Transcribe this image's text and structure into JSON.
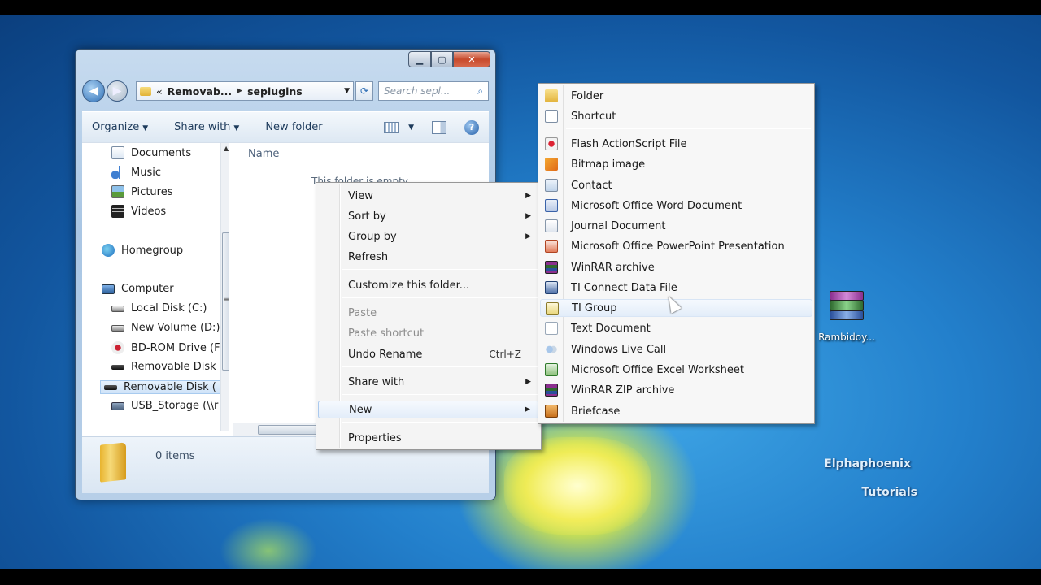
{
  "explorer": {
    "address": {
      "overflow": "«",
      "crumbs": [
        "Removab...",
        "seplugins"
      ]
    },
    "search_placeholder": "Search sepl...",
    "toolbar": {
      "organize": "Organize",
      "share_with": "Share with",
      "new_folder": "New folder"
    },
    "nav_items": [
      "Documents",
      "Music",
      "Pictures",
      "Videos",
      "Homegroup",
      "Computer",
      "Local Disk (C:)",
      "New Volume (D:)",
      "BD-ROM Drive (F",
      "Removable Disk (",
      "Removable Disk (",
      "USB_Storage (\\\\r"
    ],
    "column_name": "Name",
    "empty_message": "This folder is empty.",
    "item_count": "0 items"
  },
  "context_menu": {
    "items": [
      {
        "label": "View",
        "submenu": true
      },
      {
        "label": "Sort by",
        "submenu": true
      },
      {
        "label": "Group by",
        "submenu": true
      },
      {
        "label": "Refresh"
      },
      {
        "label": "Customize this folder..."
      },
      {
        "label": "Paste",
        "disabled": true
      },
      {
        "label": "Paste shortcut",
        "disabled": true
      },
      {
        "label": "Undo Rename",
        "shortcut": "Ctrl+Z"
      },
      {
        "label": "Share with",
        "submenu": true
      },
      {
        "label": "New",
        "submenu": true,
        "highlighted": true
      },
      {
        "label": "Properties"
      }
    ]
  },
  "new_submenu": {
    "items": [
      {
        "label": "Folder",
        "icon": "folder-icon"
      },
      {
        "label": "Shortcut",
        "icon": "shortcut-icon"
      },
      {
        "label": "Flash ActionScript File",
        "icon": "flash-file-icon"
      },
      {
        "label": "Bitmap image",
        "icon": "bitmap-icon"
      },
      {
        "label": "Contact",
        "icon": "contact-icon"
      },
      {
        "label": "Microsoft Office Word Document",
        "icon": "word-icon"
      },
      {
        "label": "Journal Document",
        "icon": "journal-icon"
      },
      {
        "label": "Microsoft Office PowerPoint Presentation",
        "icon": "powerpoint-icon"
      },
      {
        "label": "WinRAR archive",
        "icon": "winrar-icon"
      },
      {
        "label": "TI Connect Data File",
        "icon": "ti-connect-icon"
      },
      {
        "label": "TI Group",
        "icon": "ti-group-icon",
        "highlighted": true
      },
      {
        "label": "Text Document",
        "icon": "text-document-icon"
      },
      {
        "label": "Windows Live Call",
        "icon": "windows-live-call-icon"
      },
      {
        "label": "Microsoft Office Excel Worksheet",
        "icon": "excel-icon"
      },
      {
        "label": "WinRAR ZIP archive",
        "icon": "winrar-zip-icon"
      },
      {
        "label": "Briefcase",
        "icon": "briefcase-icon"
      }
    ]
  },
  "desktop": {
    "icon_label": "Rambidoy...",
    "watermark_line1": "Elphaphoenix",
    "watermark_line2": "Tutorials"
  },
  "colors": {
    "desktop": "#2380cc",
    "menu_highlight": "#e3edf9",
    "window_frame": "#a9c6e4"
  }
}
